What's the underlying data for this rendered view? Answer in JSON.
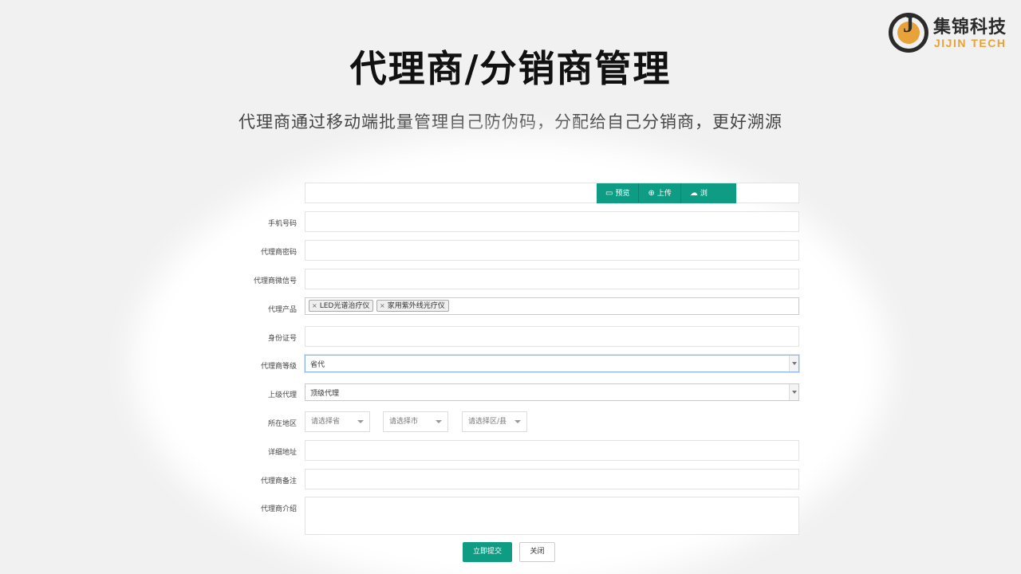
{
  "brand": {
    "mark": "J",
    "name_cn": "集锦科技",
    "name_en": "JIJIN TECH"
  },
  "page": {
    "title": "代理商/分销商管理",
    "subtitle": "代理商通过移动端批量管理自己防伪码，分配给自己分销商，更好溯源"
  },
  "toolbar": {
    "preview": "预览",
    "upload": "上传",
    "third": "浏"
  },
  "form": {
    "labels": {
      "phone": "手机号码",
      "password": "代理商密码",
      "wechat": "代理商微信号",
      "products": "代理产品",
      "id_number": "身份证号",
      "level": "代理商等级",
      "parent": "上级代理",
      "region": "所在地区",
      "address": "详细地址",
      "remark": "代理商备注",
      "intro": "代理商介绍"
    },
    "products": [
      "LED光谱治疗仪",
      "家用紫外线光疗仪"
    ],
    "level_value": "省代",
    "parent_value": "顶级代理",
    "region": {
      "province_placeholder": "请选择省",
      "city_placeholder": "请选择市",
      "district_placeholder": "请选择区/县"
    },
    "submit": "立即提交",
    "close": "关闭"
  },
  "colors": {
    "accent": "#0f9c85",
    "logo_orange": "#e8a23a",
    "background": "#f1f1f1"
  }
}
